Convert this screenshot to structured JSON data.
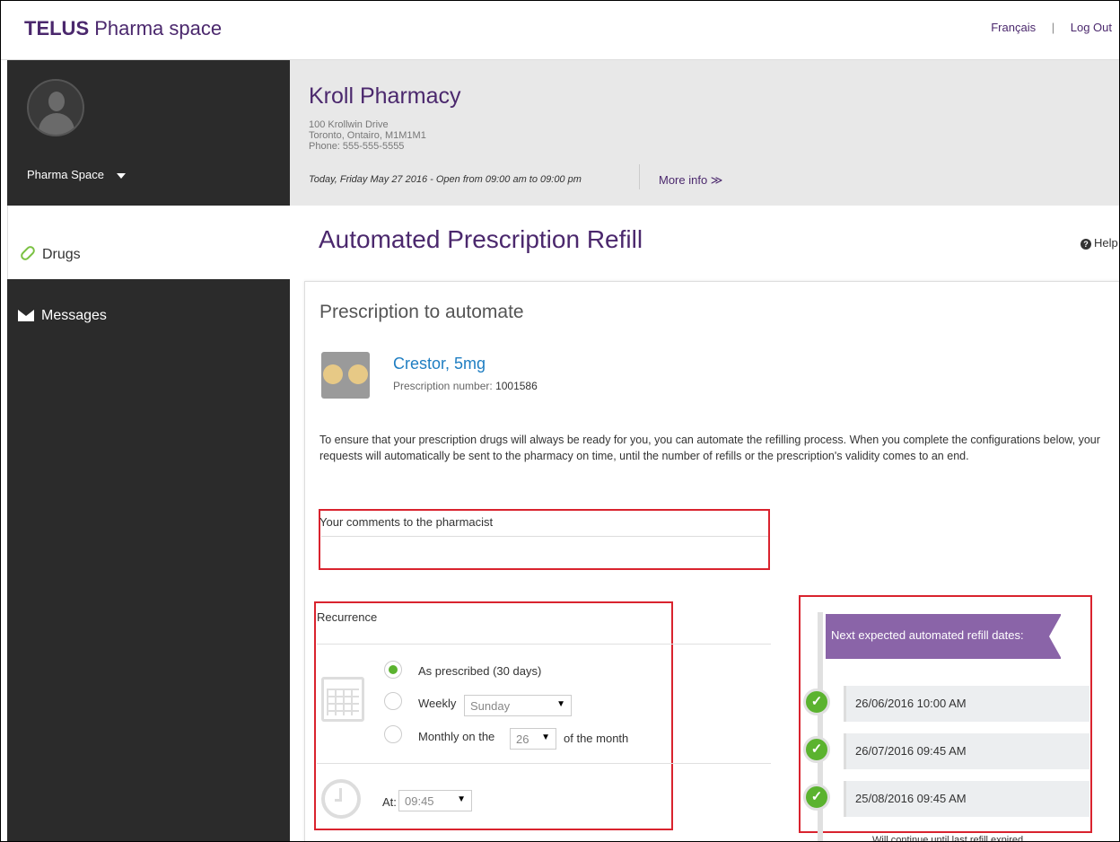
{
  "brand": {
    "bold": "TELUS",
    "rest": "Pharma space"
  },
  "top_links": {
    "language": "Français",
    "separator": "|",
    "logout": "Log Out"
  },
  "sidebar": {
    "profile_name": "Pharma Space",
    "items": [
      {
        "label": "Drugs",
        "icon": "pill-icon",
        "active": true
      },
      {
        "label": "Messages",
        "icon": "envelope-icon",
        "active": false
      }
    ]
  },
  "pharmacy": {
    "name": "Kroll Pharmacy",
    "address_line1": "100 Krollwin Drive",
    "address_line2": "Toronto, Ontairo, M1M1M1",
    "phone": "Phone: 555-555-5555",
    "hours": "Today, Friday May 27 2016 - Open from 09:00 am to 09:00 pm",
    "more_info": "More info ≫"
  },
  "page": {
    "title": "Automated Prescription Refill",
    "help": "Help"
  },
  "card": {
    "title": "Prescription to automate",
    "drug_name": "Crestor, 5mg",
    "rx_label": "Prescription number:",
    "rx_number": "1001586",
    "intro": "To ensure that your prescription drugs will always be ready for you, you can automate the refilling process. When you complete the configurations below, your requests will automatically be sent to the pharmacy on time, until the number of refills or the prescription's validity comes to an end.",
    "comments_label": "Your comments to the pharmacist",
    "comments_value": ""
  },
  "recurrence": {
    "title": "Recurrence",
    "options": [
      {
        "label": "As prescribed (30 days)",
        "selected": true
      },
      {
        "label": "Weekly",
        "selected": false
      },
      {
        "label": "Monthly on the",
        "selected": false
      }
    ],
    "weekly_day": "Sunday",
    "monthly_day": "26",
    "monthly_suffix": "of the month",
    "at_label": "At:",
    "at_time": "09:45"
  },
  "refills": {
    "banner": "Next expected automated refill dates:",
    "dates": [
      "26/06/2016 10:00 AM",
      "26/07/2016 09:45 AM",
      "25/08/2016 09:45 AM"
    ],
    "note": "Will continue until last refill expired"
  },
  "colors": {
    "brand_purple": "#4b286d",
    "accent_green": "#5bb32f",
    "banner_purple": "#8a64a8",
    "highlight_red": "#d9232e"
  }
}
